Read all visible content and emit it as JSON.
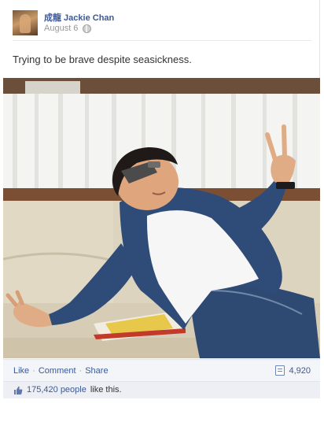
{
  "post": {
    "author": "成龍 Jackie Chan",
    "date": "August 6",
    "message": "Trying to be brave despite seasickness."
  },
  "actions": {
    "like": "Like",
    "comment": "Comment",
    "share": "Share",
    "separator": "·",
    "share_count": "4,920"
  },
  "likes": {
    "count_link": "175,420 people",
    "suffix": "like this."
  },
  "icons": {
    "privacy": "globe-icon",
    "share_count": "document-icon",
    "like": "thumbs-up-icon"
  },
  "colors": {
    "link": "#3b5998",
    "meta": "#999999",
    "ufi_background": "#f3f5f8"
  }
}
